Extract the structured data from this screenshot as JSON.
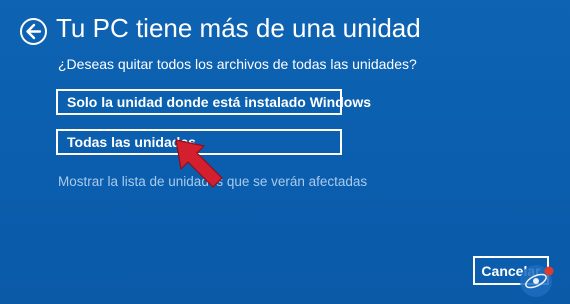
{
  "dialog": {
    "title": "Tu PC tiene más de una unidad",
    "question": "¿Deseas quitar todos los archivos de todas las unidades?"
  },
  "options": {
    "solo_label": "Solo la unidad donde está instalado Windows",
    "todas_label": "Todas las unidades"
  },
  "link": {
    "label": "Mostrar la lista de unidades que se verán afectadas"
  },
  "footer": {
    "cancel_label": "Cancelar"
  },
  "icons": {
    "back": "back-arrow-icon",
    "annotation": "red-pointer-arrow-icon",
    "watermark": "logo-icon"
  },
  "colors": {
    "background": "#0b5faf",
    "text": "#ffffff",
    "link": "#a8cbee",
    "annotation": "#d4202e"
  }
}
